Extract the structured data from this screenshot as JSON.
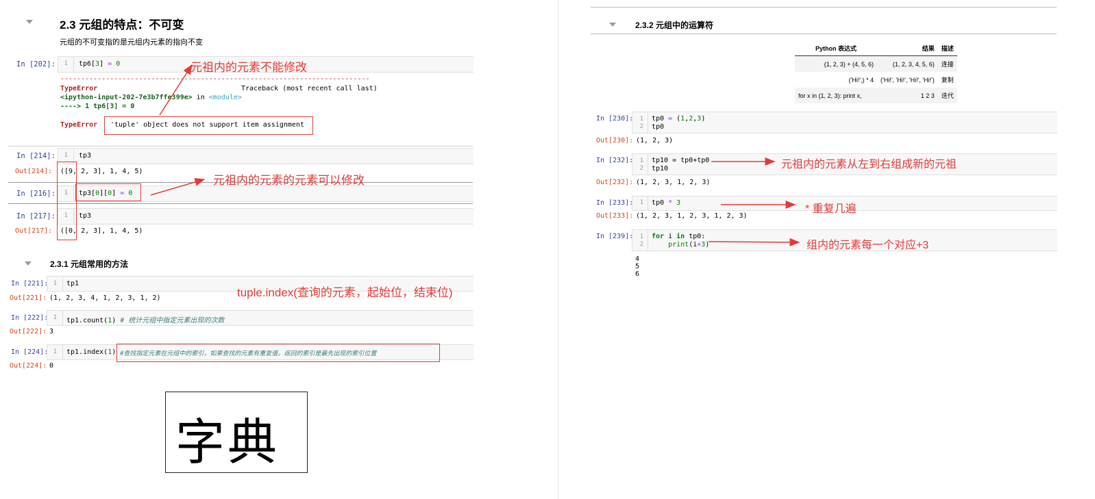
{
  "left": {
    "section_title": "2.3  元组的特点：不可变",
    "section_desc": "元组的不可变指的是元组内元素的指向不变",
    "cell202": {
      "prompt": "In [202]:",
      "lineno": "1",
      "tb_dashes": "---------------------------------------------------------------------------",
      "tb_error": "TypeError",
      "tb_header": "Traceback (most recent call last)",
      "tb_input": "<ipython-input-202-7e3b7ffe399e>",
      "tb_in": " in ",
      "tb_module": "<module>",
      "tb_arrow": "----> 1 tp6[3] = 0",
      "err_name": "TypeError",
      "err_msg": "'tuple' object does not support item assignment"
    },
    "cell214": {
      "prompt": "In [214]:",
      "lineno": "1",
      "code": "tp3",
      "out_prompt": "Out[214]:",
      "out": "([9, 2, 3], 1, 4, 5)"
    },
    "cell216": {
      "prompt": "In [216]:",
      "lineno": "1"
    },
    "cell217": {
      "prompt": "In [217]:",
      "lineno": "1",
      "code": "tp3",
      "out_prompt": "Out[217]:",
      "out": "([0, 2, 3], 1, 4, 5)"
    },
    "subsection_title": "2.3.1  元组常用的方法",
    "cell221": {
      "prompt": "In [221]:",
      "lineno": "1",
      "code": "tp1",
      "out_prompt": "Out[221]:",
      "out": "(1, 2, 3, 4, 1, 2, 3, 1, 2)"
    },
    "cell222": {
      "prompt": "In [222]:",
      "lineno": "1",
      "code_a": "tp1.count(",
      "code_num": "1",
      "code_b": ")",
      "comment": " # 统计元组中指定元素出现的次数",
      "out_prompt": "Out[222]:",
      "out": "3"
    },
    "cell224": {
      "prompt": "In [224]:",
      "lineno": "1",
      "code_a": "tp1.index(",
      "code_num": "1",
      "code_b": ")",
      "comment": "#查找指定元素在元组中的索引，如果查找的元素有重复值，返回的索引是最先出现的索引位置",
      "out_prompt": "Out[224]:",
      "out": "0"
    },
    "annotations": {
      "a1": "元祖内的元素不能修改",
      "a2": "元祖内的元素的元素可以修改",
      "a3": "tuple.index(查询的元素，起始位，结束位)"
    },
    "dict_label": "字典"
  },
  "right": {
    "subsection_title": "2.3.2  元组中的运算符",
    "table": {
      "headers": [
        "Python 表达式",
        "结果",
        "描述"
      ],
      "rows": [
        [
          "(1, 2, 3) + (4, 5, 6)",
          "(1, 2, 3, 4, 5, 6)",
          "连接"
        ],
        [
          "('Hi!',) * 4",
          "('Hi!', 'Hi!', 'Hi!', 'Hi!')",
          "复制"
        ],
        [
          "for x in (1, 2, 3): print x,",
          "1 2 3",
          "迭代"
        ]
      ]
    },
    "cell230": {
      "prompt": "In [230]:",
      "ln1": "1",
      "ln2": "2",
      "line2": "tp0",
      "out_prompt": "Out[230]:",
      "out": "(1, 2, 3)"
    },
    "cell232": {
      "prompt": "In [232]:",
      "ln1": "1",
      "ln2": "2",
      "line1": "tp10 = tp0+tp0",
      "line2": "tp10",
      "out_prompt": "Out[232]:",
      "out": "(1, 2, 3, 1, 2, 3)"
    },
    "cell233": {
      "prompt": "In [233]:",
      "ln1": "1",
      "out_prompt": "Out[233]:",
      "out": "(1, 2, 3, 1, 2, 3, 1, 2, 3)"
    },
    "cell239": {
      "prompt": "In [239]:",
      "ln1": "1",
      "ln2": "2",
      "out_lines": [
        "4",
        "5",
        "6"
      ]
    },
    "annotations": {
      "b1": "元祖内的元素从左到右组成新的元祖",
      "b2": "*  重复几遍",
      "b3": "组内的元素每一个对应+3"
    }
  },
  "colors": {
    "annotation": "#e53935",
    "prompt_in": "#303f9f",
    "prompt_out": "#d84315",
    "keyword": "#008000"
  }
}
